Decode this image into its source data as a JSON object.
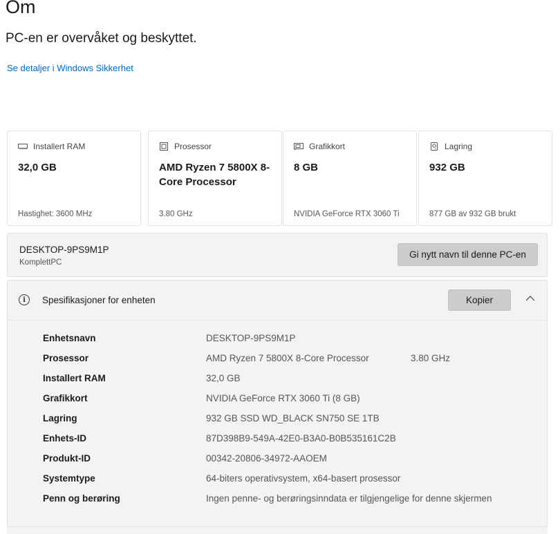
{
  "header": {
    "title": "Om",
    "protection_status": "PC-en er overvåket og beskyttet.",
    "security_link": "Se detaljer i Windows Sikkerhet"
  },
  "cards": [
    {
      "label": "Installert RAM",
      "value": "32,0 GB",
      "detail": "Hastighet: 3600 MHz",
      "icon": "ram-icon"
    },
    {
      "label": "Prosessor",
      "value": "AMD Ryzen 7 5800X 8-Core Processor",
      "detail": "3.80 GHz",
      "icon": "processor-icon"
    },
    {
      "label": "Grafikkort",
      "value": "8 GB",
      "detail": "NVIDIA GeForce RTX 3060 Ti",
      "icon": "graphics-card-icon"
    },
    {
      "label": "Lagring",
      "value": "932 GB",
      "detail": "877 GB av 932 GB brukt",
      "icon": "storage-icon"
    }
  ],
  "device": {
    "name": "DESKTOP-9PS9M1P",
    "model": "KomplettPC",
    "rename_button": "Gi nytt navn til denne PC-en"
  },
  "specs": {
    "title": "Spesifikasjoner for enheten",
    "copy_button": "Kopier",
    "rows": [
      {
        "label": "Enhetsnavn",
        "value": "DESKTOP-9PS9M1P",
        "extra": ""
      },
      {
        "label": "Prosessor",
        "value": "AMD Ryzen 7 5800X 8-Core Processor",
        "extra": "3.80 GHz"
      },
      {
        "label": "Installert RAM",
        "value": "32,0 GB",
        "extra": ""
      },
      {
        "label": "Grafikkort",
        "value": "NVIDIA GeForce RTX 3060 Ti (8 GB)",
        "extra": ""
      },
      {
        "label": "Lagring",
        "value": "932 GB SSD WD_BLACK SN750 SE 1TB",
        "extra": ""
      },
      {
        "label": "Enhets-ID",
        "value": "87D398B9-549A-42E0-B3A0-B0B535161C2B",
        "extra": ""
      },
      {
        "label": "Produkt-ID",
        "value": "00342-20806-34972-AAOEM",
        "extra": ""
      },
      {
        "label": "Systemtype",
        "value": "64-biters operativsystem, x64-basert prosessor",
        "extra": ""
      },
      {
        "label": "Penn og berøring",
        "value": "Ingen penne- og berøringsinndata er tilgjengelige for denne skjermen",
        "extra": ""
      }
    ]
  },
  "colors": {
    "link": "#0067c0",
    "panel_background": "#f3f3f3",
    "button_background": "#cccccc"
  }
}
